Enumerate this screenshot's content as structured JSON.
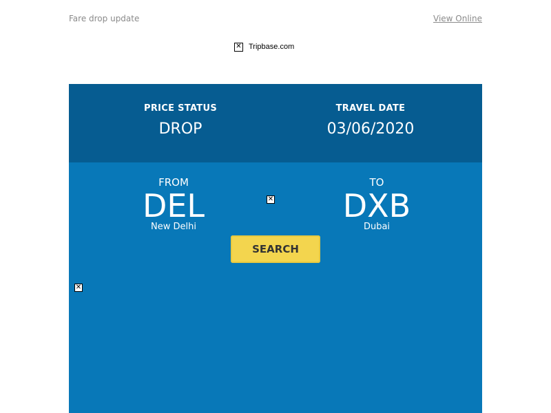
{
  "header": {
    "preheader_text": "Fare drop update",
    "view_online_label": "View Online",
    "logo_alt": "Tripbase.com"
  },
  "card": {
    "price_status_label": "PRICE STATUS",
    "price_status_value": "DROP",
    "travel_date_label": "TRAVEL DATE",
    "travel_date_value": "03/06/2020",
    "from": {
      "label": "FROM",
      "code": "DEL",
      "city": "New Delhi"
    },
    "to": {
      "label": "TO",
      "code": "DXB",
      "city": "Dubai"
    },
    "search_label": "SEARCH"
  },
  "broken_image_glyph": "✕",
  "colors": {
    "card_background": "#0878b8",
    "card_header_background": "#065c91",
    "search_button": "#f3d54e",
    "muted_text": "#8a8a8a"
  }
}
